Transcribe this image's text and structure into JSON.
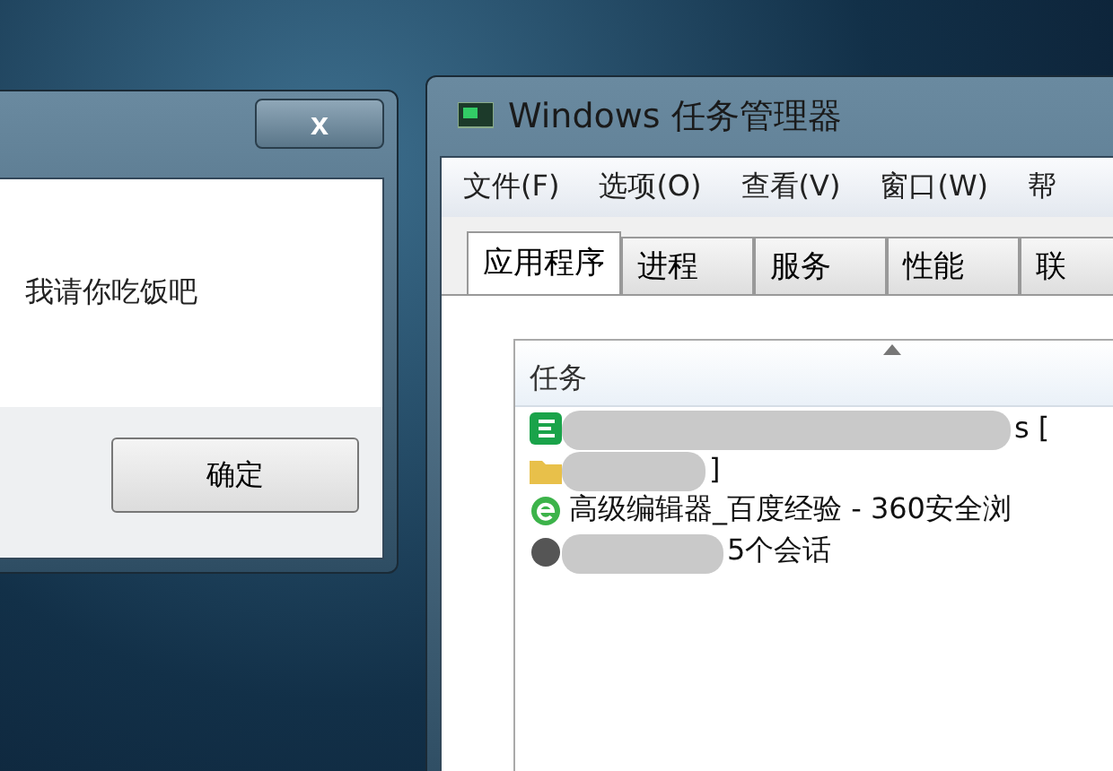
{
  "message_box": {
    "close": "x",
    "message": "我请你吃饭吧",
    "buttons": [
      "确定"
    ]
  },
  "task_manager": {
    "title": "Windows 任务管理器",
    "menu": [
      "文件(F)",
      "选项(O)",
      "查看(V)",
      "窗口(W)",
      "帮"
    ],
    "tabs": [
      {
        "label": "应用程序",
        "selected": true
      },
      {
        "label": "进程",
        "selected": false
      },
      {
        "label": "服务",
        "selected": false
      },
      {
        "label": "性能",
        "selected": false
      },
      {
        "label": "联",
        "selected": false
      }
    ],
    "table": {
      "columns": [
        "任务"
      ],
      "rows": [
        {
          "task": "s [",
          "redacted": true
        },
        {
          "task": "]",
          "redacted": true
        },
        {
          "task": "高级编辑器_百度经验 - 360安全浏",
          "redacted": false
        },
        {
          "task": "5个会话",
          "redacted": true
        }
      ]
    }
  }
}
